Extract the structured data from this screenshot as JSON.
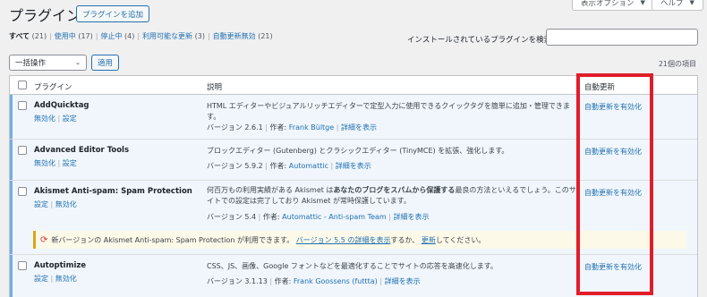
{
  "header": {
    "title": "プラグイン",
    "add_label": "プラグインを追加",
    "screen_options": "表示オプション",
    "help": "ヘルプ"
  },
  "filters": {
    "all": {
      "label": "すべて",
      "count": "(21)"
    },
    "active": {
      "label": "使用中",
      "count": "(17)"
    },
    "inactive": {
      "label": "停止中",
      "count": "(4)"
    },
    "updates": {
      "label": "利用可能な更新",
      "count": "(3)"
    },
    "auto_off": {
      "label": "自動更新無効",
      "count": "(21)"
    }
  },
  "search": {
    "label": "インストールされているプラグインを検索",
    "value": ""
  },
  "bulk": {
    "selected": "一括操作",
    "apply": "適用"
  },
  "items_count": "21個の項目",
  "columns": {
    "plugin": "プラグイン",
    "description": "説明",
    "auto_update": "自動更新"
  },
  "plugins": [
    {
      "name": "AddQuicktag",
      "action1": "無効化",
      "action2": "設定",
      "desc": "HTML エディターやビジュアルリッチエディターで定型入力に使用できるクイックタグを簡単に追加・管理できます。",
      "version": "バージョン 2.6.1",
      "by": "作者:",
      "author": "Frank Bültge",
      "details": "詳細を表示",
      "auto": "自動更新を有効化"
    },
    {
      "name": "Advanced Editor Tools",
      "action1": "無効化",
      "action2": "設定",
      "desc": "ブロックエディター (Gutenberg) とクラシックエディター (TinyMCE) を拡張、強化します。",
      "version": "バージョン 5.9.2",
      "by": "作者:",
      "author": "Automattic",
      "details": "詳細を表示",
      "auto": "自動更新を有効化"
    },
    {
      "name": "Akismet Anti-spam: Spam Protection",
      "action1": "設定",
      "action2": "無効化",
      "desc_pre": "何百万もの利用実績がある Akismet は",
      "desc_bold": "あなたのブログをスパムから保護する",
      "desc_post": "最良の方法といえるでしょう。このサイトでの設定は完了しており Akismet が常時保護しています。",
      "version": "バージョン 5.4",
      "by": "作者:",
      "author": "Automattic - Anti-spam Team",
      "details": "詳細を表示",
      "auto": "自動更新を有効化"
    },
    {
      "name": "Autoptimize",
      "action1": "設定",
      "action2": "無効化",
      "desc": "CSS、JS、画像、Google フォントなどを最適化することでサイトの応答を高速化します。",
      "version": "バージョン 3.1.13",
      "by": "作者:",
      "author": "Frank Goossens (futtta)",
      "details": "詳細を表示",
      "auto": "自動更新を有効化"
    }
  ],
  "notice": {
    "pre": "新バージョンの Akismet Anti-spam: Spam Protection が利用できます。",
    "link": "バージョン 5.5 の詳細を表示",
    "mid": "するか、",
    "update": "更新",
    "post": "してください。"
  },
  "colors": {
    "link": "#2271b1",
    "highlight": "#e11d2a",
    "notice_border": "#dba617",
    "active_bar": "#72aee6"
  }
}
